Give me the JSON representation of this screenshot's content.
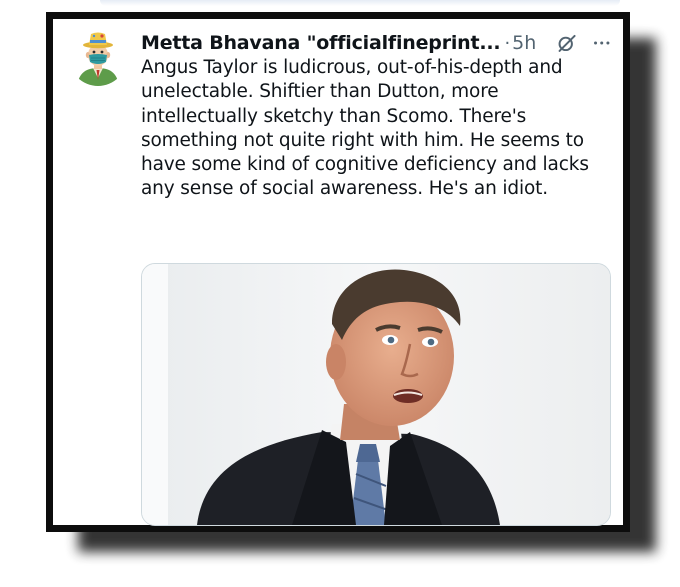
{
  "tweet": {
    "display_name": "Metta Bhavana \"officialfineprint...",
    "separator": "·",
    "timestamp": "5h",
    "icons": {
      "avatar": "cartoon-man-with-mask-avatar",
      "grok": "grok-slash-circle-icon",
      "more": "more-dots-icon"
    },
    "text": "Angus Taylor is ludicrous, out-of-his-depth and unelectable. Shiftier than Dutton, more intellectually sketchy than Scomo. There's something not quite right with him. He seems to have some kind of cognitive deficiency and lacks any sense of social awareness. He's an idiot.",
    "media": {
      "kind": "photo",
      "subject": "man-in-suit-speaking-photo"
    }
  },
  "colors": {
    "text_primary": "#0f1419",
    "text_secondary": "#536471",
    "frame_border": "#0d0d0d",
    "media_border": "#cfd9de"
  }
}
